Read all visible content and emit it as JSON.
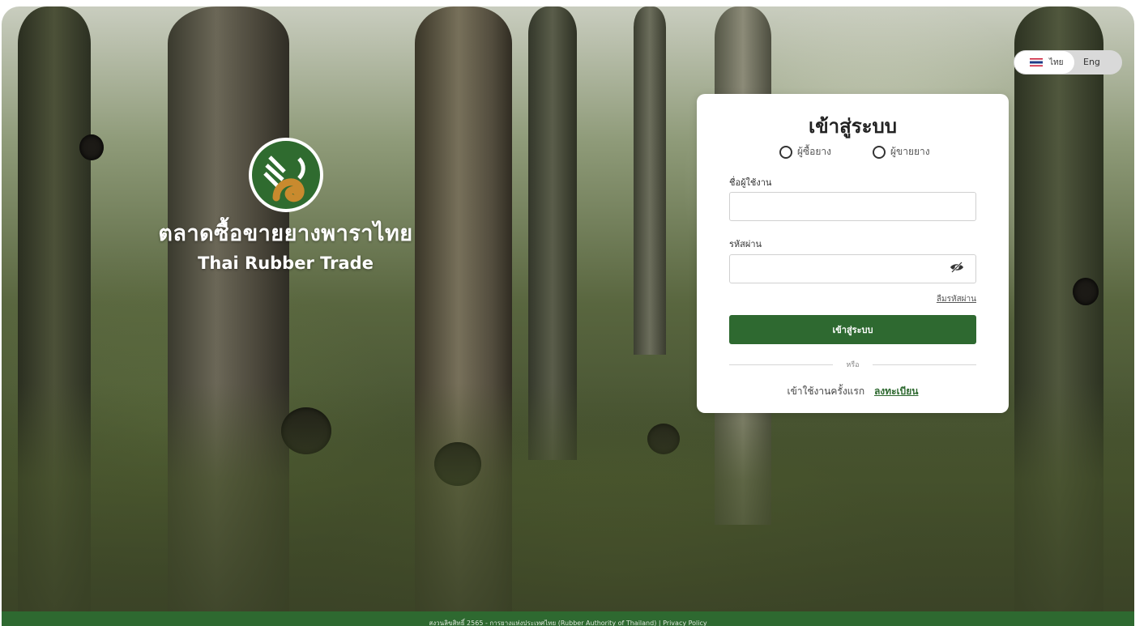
{
  "brand": {
    "title_th": "ตลาดซื้อขายยางพาราไทย",
    "title_en": "Thai Rubber Trade"
  },
  "language": {
    "thai_label": "ไทย",
    "english_label": "Eng",
    "selected": "ไทย"
  },
  "login": {
    "title": "เข้าสู่ระบบ",
    "roles": [
      {
        "label": "ผู้ซื้อยาง",
        "selected": false
      },
      {
        "label": "ผู้ขายยาง",
        "selected": false
      }
    ],
    "username_label": "ชื่อผู้ใช้งาน",
    "username_value": "",
    "password_label": "รหัสผ่าน",
    "password_value": "",
    "forgot_label": "ลืมรหัสผ่าน",
    "submit_label": "เข้าสู่ระบบ",
    "or_label": "หรือ",
    "first_time_text": "เข้าใช้งานครั้งแรก",
    "register_label": "ลงทะเบียน"
  },
  "footer": {
    "copyright": "สงวนลิขสิทธิ์ 2565 - การยางแห่งประเทศไทย (Rubber Authority of Thailand) |",
    "privacy_label": "Privacy Policy"
  },
  "colors": {
    "primary_green": "#2e6930",
    "logo_gold": "#c98a2e"
  }
}
